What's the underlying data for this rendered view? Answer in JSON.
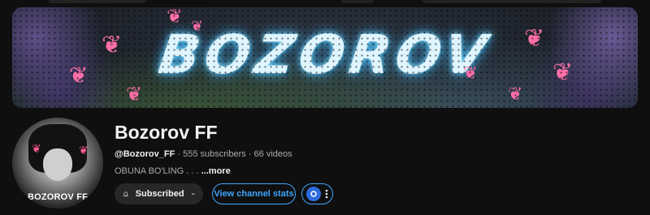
{
  "banner": {
    "title": "BOZOROV"
  },
  "avatar": {
    "label": "BOZOROV FF"
  },
  "channel": {
    "name": "Bozorov FF",
    "handle": "@Bozorov_FF",
    "subscribers": "555 subscribers",
    "videos": "66 videos",
    "separator": "·",
    "description": "OBUNA BO'LING . . . ",
    "more_label": "...more"
  },
  "buttons": {
    "subscribed_label": "Subscribed",
    "view_stats_label": "View channel stats"
  },
  "icons": {
    "bell": "bell-icon",
    "chevron": "chevron-down-icon",
    "extension": "extension-logo-icon",
    "more": "more-vert-icon"
  },
  "colors": {
    "background": "#0f0f0f",
    "accent_blue": "#3ea6ff",
    "secondary_text": "#aaaaaa",
    "button_bg": "#272727",
    "butterfly_pink": "#ff6fa8"
  }
}
